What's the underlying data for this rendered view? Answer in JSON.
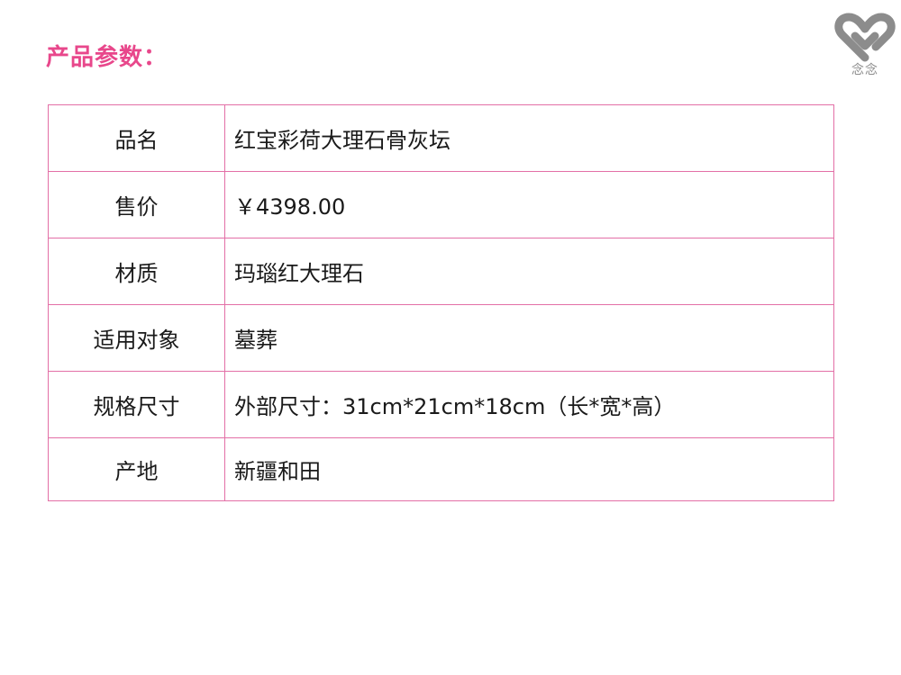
{
  "heading": "产品参数：",
  "logo": {
    "icon": "heart-ribbon-icon",
    "text": "念念"
  },
  "colors": {
    "accent": "#e8478b",
    "border": "#e36fa6",
    "logo": "#8c8c8c"
  },
  "specs": [
    {
      "label": "品名",
      "value": "红宝彩荷大理石骨灰坛"
    },
    {
      "label": "售价",
      "value": "￥4398.00"
    },
    {
      "label": "材质",
      "value": "玛瑙红大理石"
    },
    {
      "label": "适用对象",
      "value": "墓葬"
    },
    {
      "label": "规格尺寸",
      "value": "外部尺寸：31cm*21cm*18cm（长*宽*高）"
    },
    {
      "label": "产地",
      "value": "新疆和田"
    }
  ]
}
